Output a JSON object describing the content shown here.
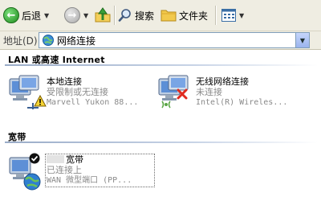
{
  "toolbar": {
    "back_label": "后退",
    "search_label": "搜索",
    "folders_label": "文件夹"
  },
  "address": {
    "label": "地址(D)",
    "value": "网络连接"
  },
  "groups": [
    {
      "title": "LAN 或高速 Internet"
    },
    {
      "title": "宽带"
    }
  ],
  "connections": [
    {
      "name": "本地连接",
      "status": "受限制或无连接",
      "device": "Marvell Yukon 88..."
    },
    {
      "name": "无线网络连接",
      "status": "未连接",
      "device": "Intel(R) Wireles..."
    },
    {
      "name": "宽带",
      "status": "已连接上",
      "device": "WAN 微型端口 (PP..."
    }
  ],
  "colors": {
    "toolbar_bg": "#efede2",
    "group_line": "#9aacc8",
    "status_text": "#8a8a8a"
  },
  "icons": [
    "back-arrow-icon",
    "forward-arrow-icon",
    "folder-up-icon",
    "search-icon",
    "folders-icon",
    "views-icon",
    "network-connections-icon",
    "lan-connection-icon",
    "warning-icon",
    "wireless-connection-icon",
    "disconnected-x-icon",
    "broadband-connection-icon",
    "connected-check-icon"
  ]
}
